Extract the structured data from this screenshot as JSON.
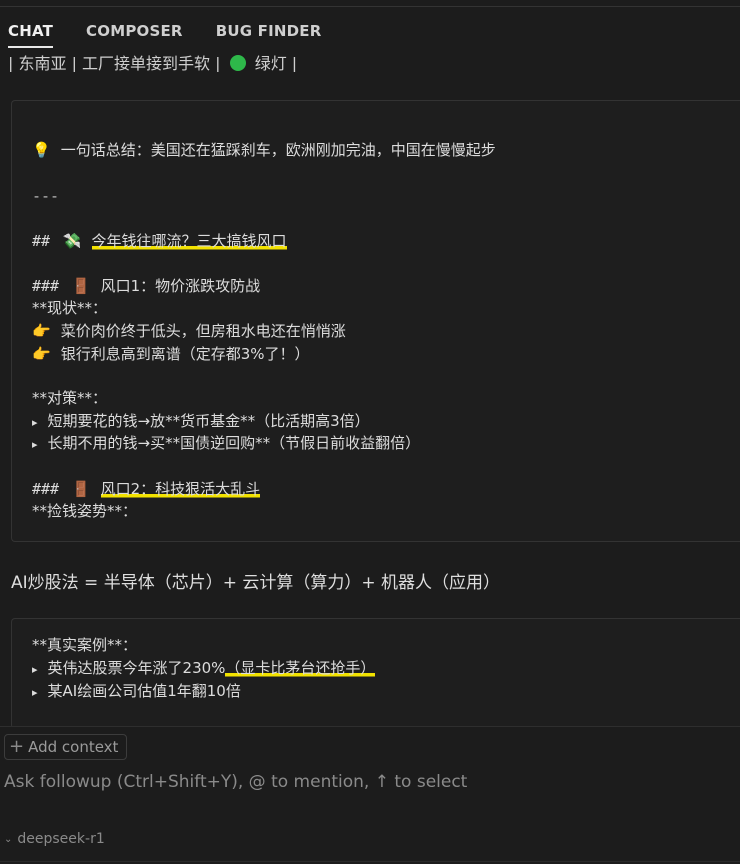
{
  "tabs": [
    {
      "label": "CHAT",
      "active": true
    },
    {
      "label": "COMPOSER",
      "active": false
    },
    {
      "label": "BUG FINDER",
      "active": false
    }
  ],
  "cut_line": {
    "before": "| 东南亚 | 工厂接单接到手软 | ",
    "after": " 绿灯 |"
  },
  "block1": {
    "summary": "一句话总结：美国还在猛踩刹车，欧洲刚加完油，中国在慢慢起步",
    "summary_emoji": "💡",
    "separator": "---",
    "h2_prefix": "##",
    "h2_emoji": "💸",
    "h2_text": "今年钱往哪流？三大搞钱风口",
    "h3a_prefix": "###",
    "h3a_emoji": "🚪",
    "h3a_text": "风口1：物价涨跌攻防战",
    "status_label": "**现状**：",
    "bullet_emoji": "👉",
    "status_items": [
      "菜价肉价终于低头，但房租水电还在悄悄涨",
      "银行利息高到离谱（定存都3%了！）"
    ],
    "strategy_label": "**对策**：",
    "arrow": "▸",
    "strategy_items": [
      "短期要花的钱→放**货币基金**（比活期高3倍）",
      "长期不用的钱→买**国债逆回购**（节假日前收益翻倍）"
    ],
    "h3b_prefix": "###",
    "h3b_emoji": "🚪",
    "h3b_text": "风口2：科技狠活大乱斗",
    "pose_label": "**捡钱姿势**："
  },
  "plain_line": "AI炒股法 = 半导体（芯片）+ 云计算（算力）+ 机器人（应用）",
  "block2": {
    "case_label": "**真实案例**：",
    "arrow": "▸",
    "case_items": [
      {
        "before": "英伟达股票今年涨了230%",
        "highlight": "（显卡比茅台还抢手）"
      },
      {
        "before": "某AI绘画公司估值1年翻10倍",
        "highlight": ""
      }
    ]
  },
  "input": {
    "add_context": "Add context",
    "placeholder": "Ask followup (Ctrl+Shift+Y), @ to mention, ↑ to select",
    "model": "deepseek-r1"
  },
  "colors": {
    "background": "#1c1c1c",
    "highlight": "#f2e200",
    "green_dot": "#2eb84a"
  }
}
